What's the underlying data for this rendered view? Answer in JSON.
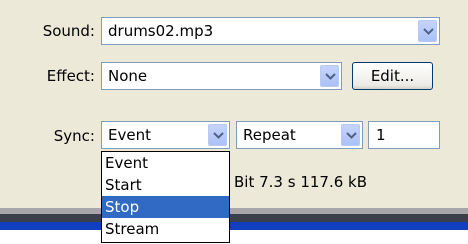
{
  "sound": {
    "label": "Sound:",
    "value": "drums02.mp3"
  },
  "effect": {
    "label": "Effect:",
    "value": "None",
    "edit_label": "Edit..."
  },
  "sync": {
    "label": "Sync:",
    "value": "Event",
    "options": [
      "Event",
      "Start",
      "Stop",
      "Stream"
    ],
    "highlighted": "Stop",
    "repeat_value": "Repeat",
    "repeat_count": "1"
  },
  "info_text": "Bit 7.3 s 117.6 kB",
  "icons": {
    "dropdown_arrow": "chevron-down-icon"
  },
  "colors": {
    "panel": "#ece9d8",
    "selection": "#316ac5",
    "accent_bar": "#0f3fbf"
  }
}
